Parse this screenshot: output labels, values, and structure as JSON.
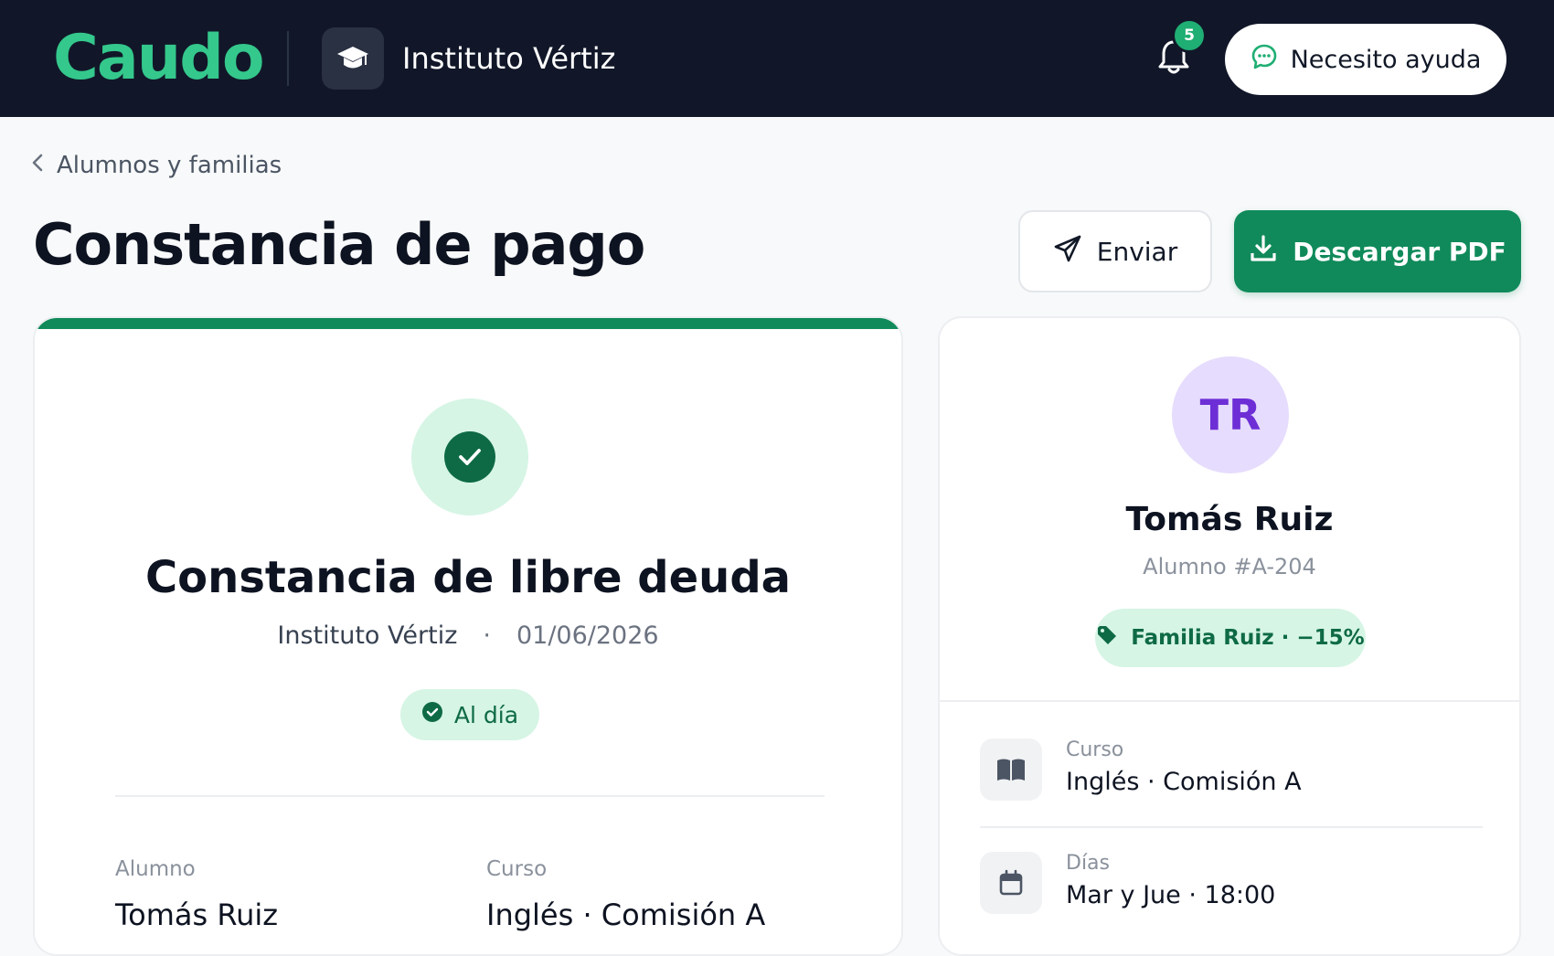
{
  "header": {
    "logo": "Caudo",
    "school_name": "Instituto Vértiz",
    "notifications_count": "5",
    "help_label": "Necesito ayuda"
  },
  "breadcrumb": {
    "back_label": "Alumnos y familias"
  },
  "page": {
    "title": "Constancia de pago",
    "send_label": "Enviar",
    "download_label": "Descargar PDF"
  },
  "receipt": {
    "title": "Constancia de libre deuda",
    "institution": "Instituto Vértiz",
    "separator": "·",
    "date": "01/06/2026",
    "status": "Al día",
    "fields": [
      {
        "label": "Alumno",
        "value": "Tomás Ruiz"
      },
      {
        "label": "Curso",
        "value": "Inglés · Comisión A"
      }
    ]
  },
  "student": {
    "initials": "TR",
    "name": "Tomás Ruiz",
    "id_label": "Alumno #A-204",
    "family_discount": "Familia Ruiz · −15%",
    "info": [
      {
        "icon": "book-icon",
        "label": "Curso",
        "value": "Inglés · Comisión A"
      },
      {
        "icon": "calendar-icon",
        "label": "Días",
        "value": "Mar y Jue · 18:00"
      }
    ]
  },
  "colors": {
    "header_bg": "#111729",
    "brand_green": "#34c88c",
    "primary": "#108a5a",
    "success_bg": "#d6f5e5",
    "avatar_bg": "#e6dcfd",
    "avatar_text": "#6d2ed6"
  }
}
